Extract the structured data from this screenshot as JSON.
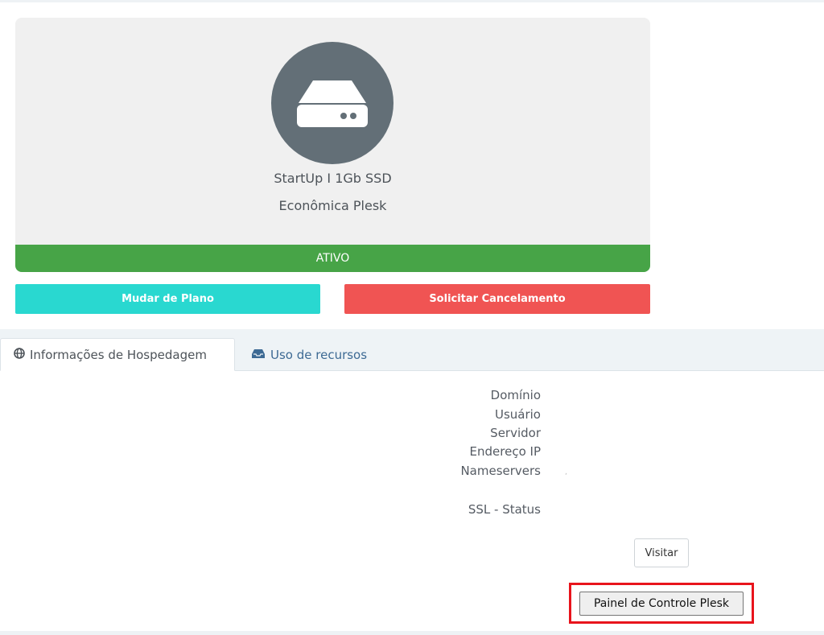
{
  "product": {
    "name": "StartUp I 1Gb SSD",
    "group": "Econômica Plesk",
    "status": "ATIVO",
    "icon": "server-icon"
  },
  "actions": {
    "upgrade_label": "Mudar de Plano",
    "cancel_label": "Solicitar Cancelamento"
  },
  "tabs": [
    {
      "label": "Informações de Hospedagem",
      "icon": "globe-icon",
      "active": true
    },
    {
      "label": "Uso de recursos",
      "icon": "inbox-icon",
      "active": false
    }
  ],
  "info": {
    "domain_label": "Domínio",
    "username_label": "Usuário",
    "server_label": "Servidor",
    "ip_label": "Endereço IP",
    "nameservers_label": "Nameservers",
    "nameservers_value": ",",
    "ssl_label": "SSL - Status"
  },
  "buttons": {
    "visit_label": "Visitar",
    "plesk_label": "Painel de Controle Plesk"
  },
  "colors": {
    "status_active": "#47a447",
    "upgrade": "#29d8d0",
    "cancel": "#f05453",
    "highlight": "#e8141c"
  }
}
